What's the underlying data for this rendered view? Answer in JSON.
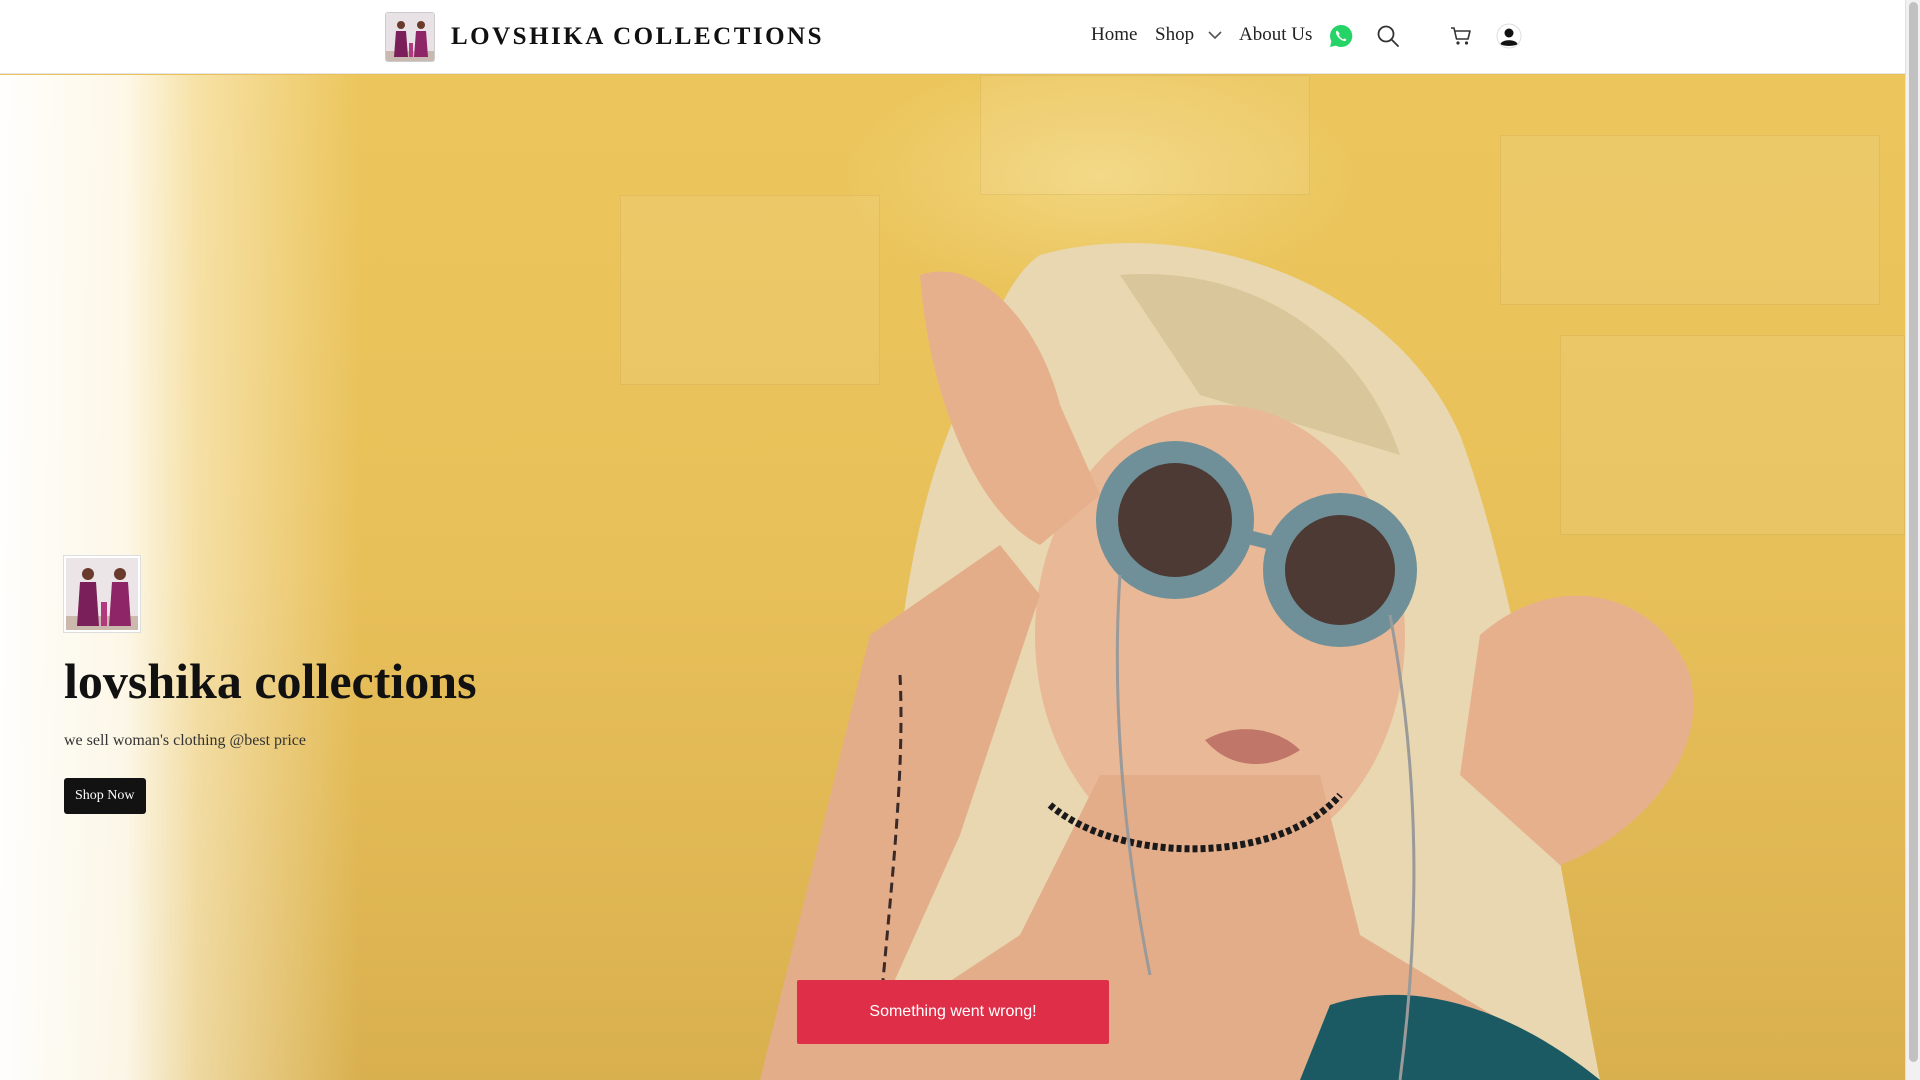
{
  "header": {
    "brand_name": "LOVSHIKA COLLECTIONS",
    "nav": {
      "home": "Home",
      "shop": "Shop",
      "about": "About Us"
    },
    "icons": [
      "whatsapp-icon",
      "search-icon",
      "cart-icon",
      "user-account-icon"
    ]
  },
  "hero": {
    "title": "lovshika collections",
    "subtitle": "we sell woman's clothing @best price",
    "cta": "Shop Now"
  },
  "toast": {
    "message": "Something went wrong!"
  },
  "colors": {
    "toast": "#df2f48",
    "button": "#121212",
    "whatsapp": "#25d366",
    "hero_bg": "#e9c25b"
  }
}
